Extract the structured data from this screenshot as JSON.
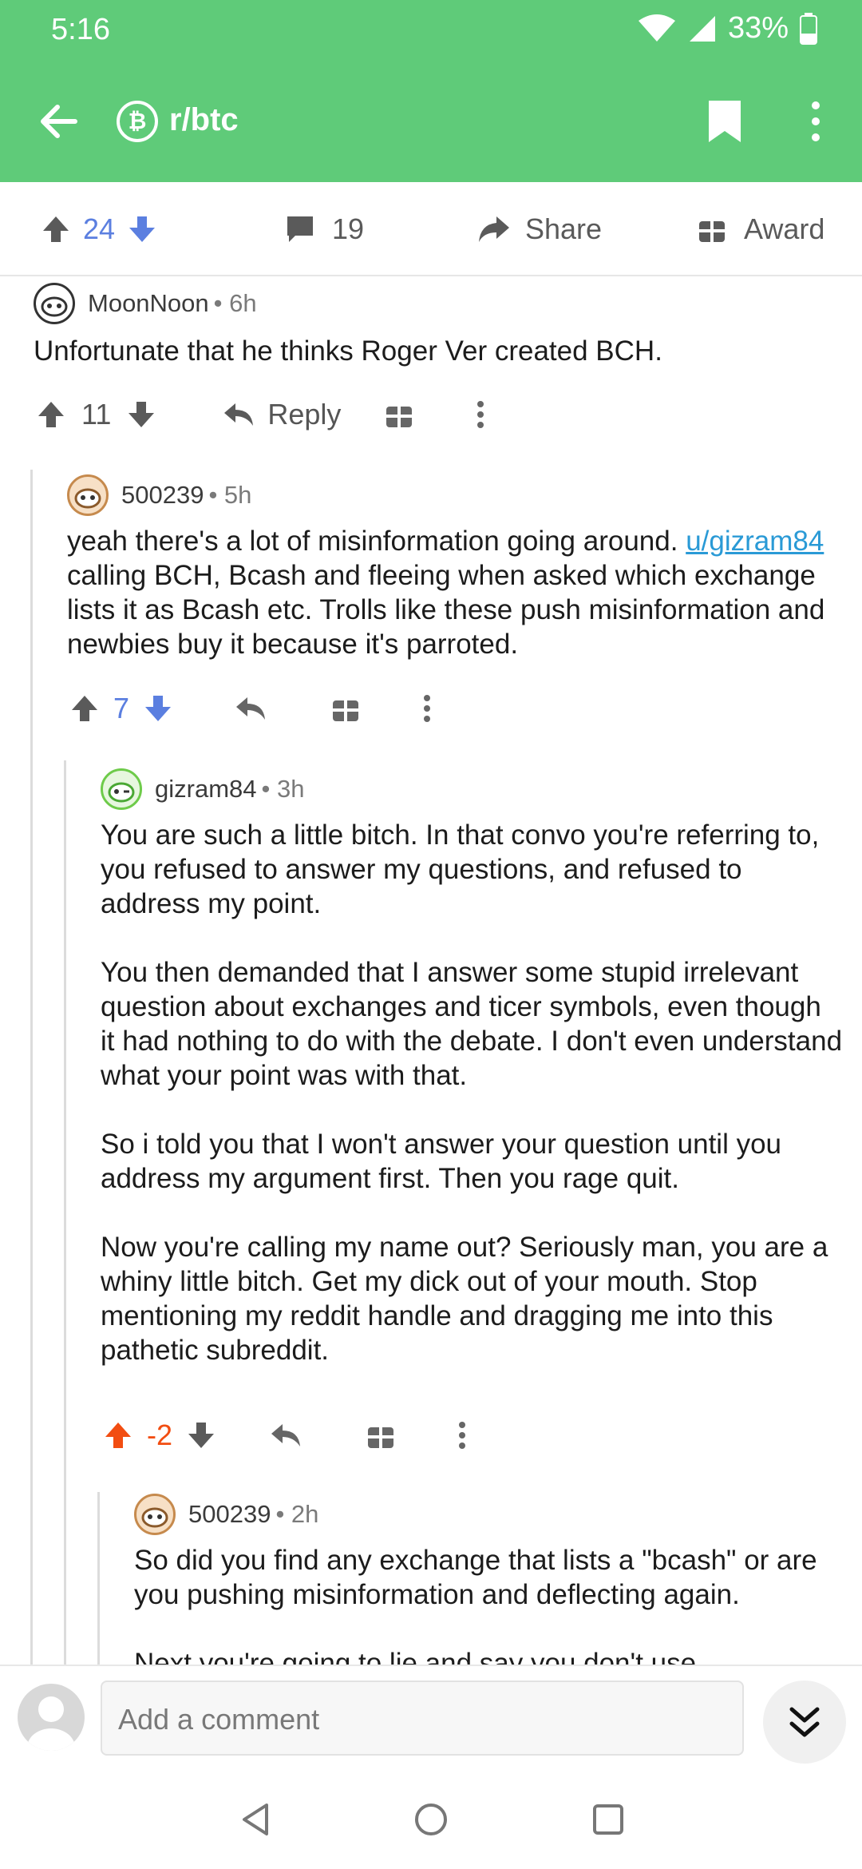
{
  "status": {
    "time": "5:16",
    "battery": "33%"
  },
  "header": {
    "subreddit": "r/btc",
    "sub_icon": "₿"
  },
  "post_actions": {
    "score": "24",
    "comments": "19",
    "share": "Share",
    "award": "Award"
  },
  "comments": [
    {
      "author": "MoonNoon",
      "age": "• 6h",
      "body": [
        "Unfortunate that he thinks Roger Ver created BCH."
      ],
      "score": "11",
      "reply_label": "Reply"
    },
    {
      "author": "500239",
      "age": "• 5h",
      "body_prefix": "yeah there's a lot of misinformation going around. ",
      "body_link": "u/gizram84",
      "body_suffix": " calling BCH, Bcash and fleeing when asked which exchange lists it as Bcash etc. Trolls like these push misinformation and newbies buy it because it's parroted.",
      "score": "7"
    },
    {
      "author": "gizram84",
      "age": "• 3h",
      "body": [
        "You are such a little bitch.  In that convo you're referring to, you refused to answer my questions, and refused to address my point.",
        "You then demanded that I answer some stupid irrelevant question about exchanges and ticer symbols, even though it had nothing to do with the debate.  I don't even understand what your point was with that.",
        "So i told you that I won't answer your question until you address my argument first.  Then you rage quit.",
        "Now you're calling my name out?  Seriously man, you are a whiny little bitch.  Get my dick out of your mouth.  Stop mentioning my reddit handle and dragging me into this pathetic subreddit."
      ],
      "score": "-2"
    },
    {
      "author": "500239",
      "age": "• 2h",
      "body": [
        "So did you find any exchange that lists a \"bcash\" or are you pushing misinformation and deflecting again.",
        "Next you're going to lie and say you don't use"
      ]
    }
  ],
  "composer": {
    "placeholder": "Add a comment"
  },
  "colors": {
    "brand_green": "#5fcb79",
    "upvote_blue": "#5b7fe0",
    "upvote_orange": "#f24d11",
    "link": "#2a9ad6"
  }
}
